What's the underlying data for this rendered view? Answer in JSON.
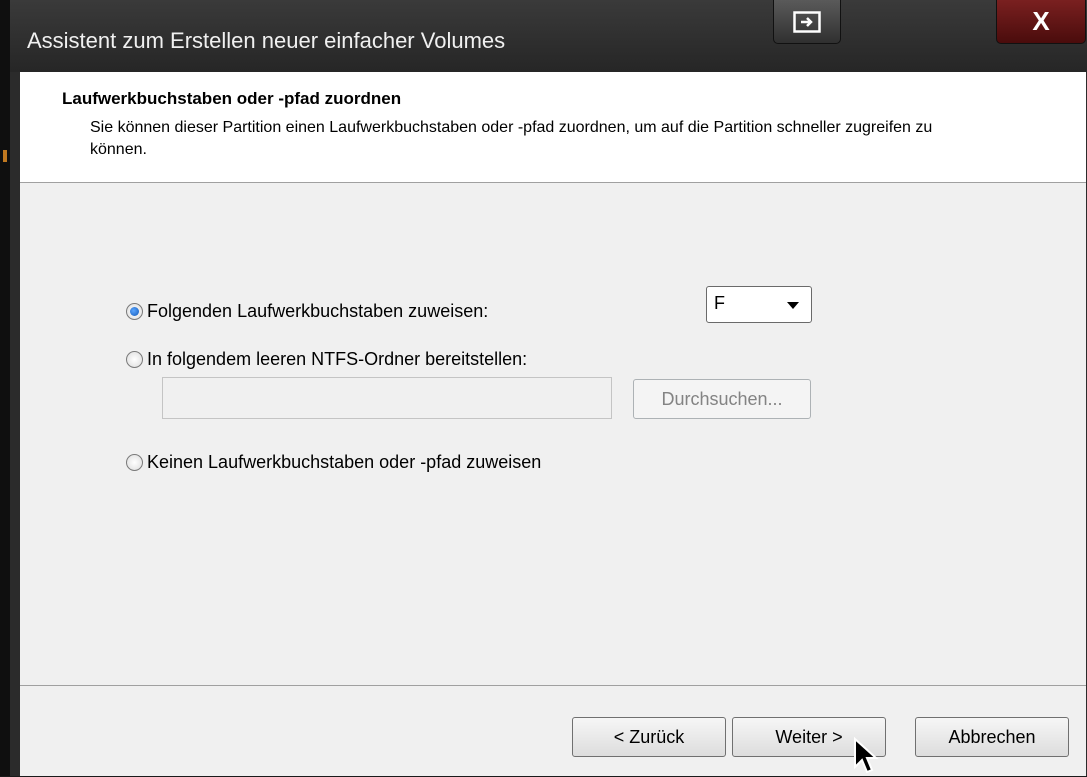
{
  "window": {
    "title": "Assistent zum Erstellen neuer einfacher Volumes",
    "close_label": "X"
  },
  "header": {
    "title": "Laufwerkbuchstaben oder -pfad zuordnen",
    "description": "Sie können dieser Partition einen Laufwerkbuchstaben oder -pfad zuordnen, um auf die Partition schneller zugreifen zu können."
  },
  "options": {
    "assign_letter": {
      "label": "Folgenden Laufwerkbuchstaben zuweisen:",
      "checked": true
    },
    "mount_folder": {
      "label": "In folgendem leeren NTFS-Ordner bereitstellen:",
      "checked": false
    },
    "no_letter": {
      "label": "Keinen Laufwerkbuchstaben oder -pfad zuweisen",
      "checked": false
    }
  },
  "drive_letter": {
    "selected": "F"
  },
  "folder_path": {
    "value": ""
  },
  "buttons": {
    "browse": "Durchsuchen...",
    "back": "< Zurück",
    "next": "Weiter >",
    "cancel": "Abbrechen"
  },
  "icons": {
    "restore": "restore-window-icon",
    "close": "close-icon",
    "cursor": "mouse-pointer-icon",
    "dropdown": "chevron-down-icon"
  }
}
